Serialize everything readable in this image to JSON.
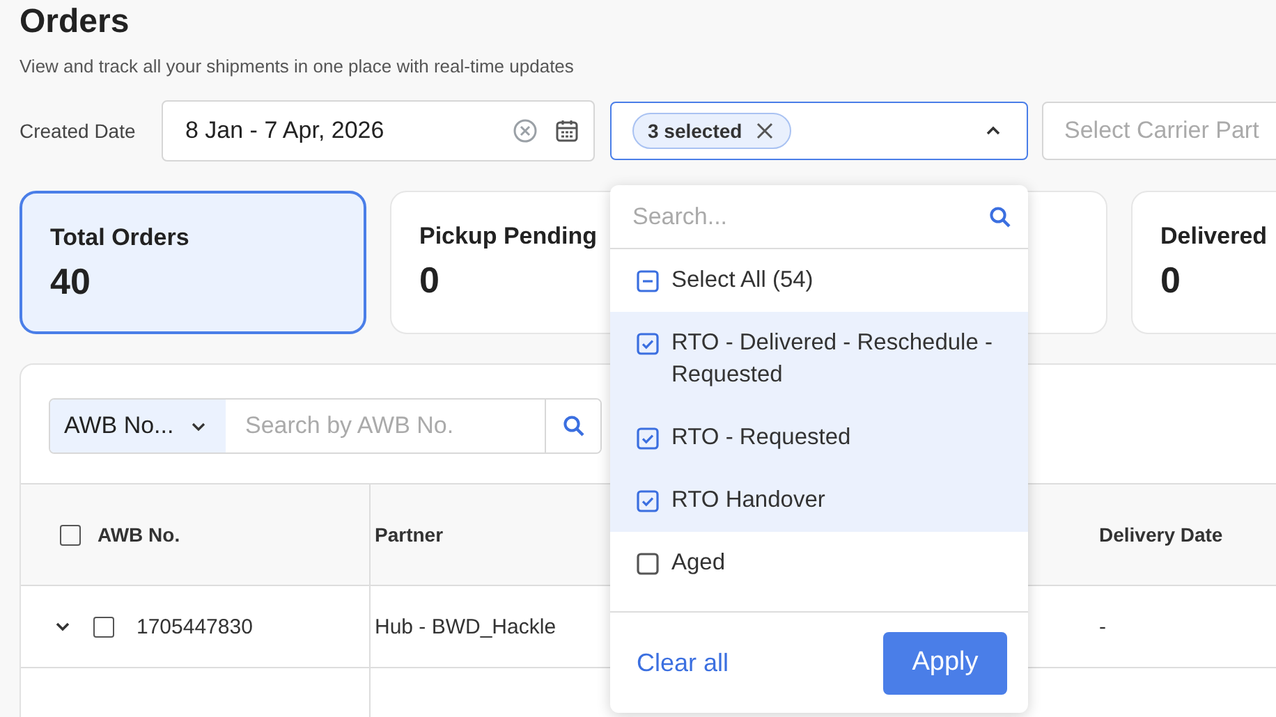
{
  "page": {
    "title": "Orders",
    "subtitle": "View and track all your shipments in one place with real-time updates"
  },
  "filters": {
    "date_label": "Created Date",
    "date_value": "8 Jan - 7 Apr, 2026",
    "status_chip": "3 selected",
    "status_open": true,
    "carrier_placeholder": "Select Carrier Part"
  },
  "cards": [
    {
      "title": "Total Orders",
      "value": "40",
      "selected": true
    },
    {
      "title": "Pickup Pending",
      "value": "0",
      "selected": false
    },
    {
      "selected": false
    },
    {
      "title": "Delivered",
      "value": "0",
      "selected": false
    }
  ],
  "search": {
    "type_label": "AWB No...",
    "placeholder": "Search by AWB No."
  },
  "table": {
    "header_checked": false,
    "columns": [
      "AWB No.",
      "Partner",
      "Delivery Date"
    ],
    "rows": [
      {
        "awb": "1705447830",
        "partner": "Hub - BWD_Hackle",
        "delivery_date": "-",
        "checked": false
      }
    ]
  },
  "dropdown": {
    "search_placeholder": "Search...",
    "select_all": {
      "label": "Select All (54)",
      "indeterminate": true
    },
    "options": [
      {
        "label": "RTO - Delivered - Reschedule - Requested",
        "checked": true
      },
      {
        "label": "RTO - Requested",
        "checked": true
      },
      {
        "label": "RTO Handover",
        "checked": true
      },
      {
        "label": "Aged",
        "checked": false
      }
    ],
    "clear_label": "Clear all",
    "apply_label": "Apply"
  }
}
